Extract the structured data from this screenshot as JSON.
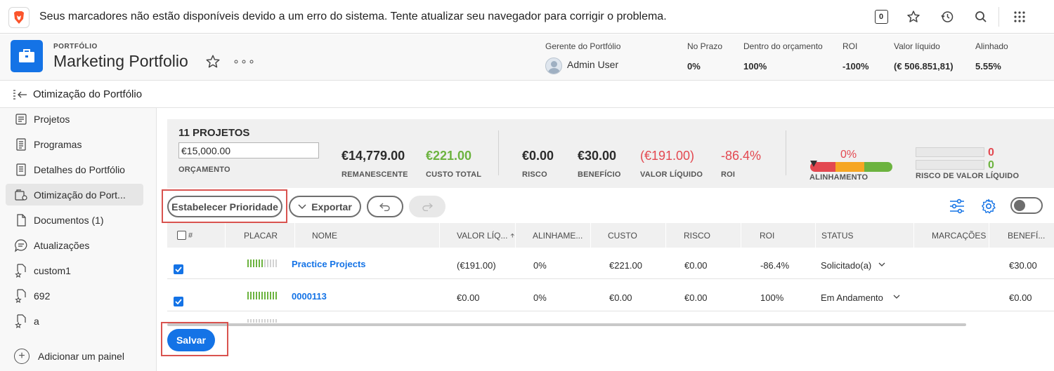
{
  "notice": {
    "text": "Seus marcadores não estão disponíveis devido a um erro do sistema. Tente atualizar seu navegador para corrigir o problema.",
    "counter": "0"
  },
  "header": {
    "label": "PORTFÓLIO",
    "title": "Marketing Portfolio",
    "more": "∘∘∘",
    "metrics": [
      {
        "label": "Gerente do Portfólio",
        "value": "Admin User"
      },
      {
        "label": "No Prazo",
        "value": "0%"
      },
      {
        "label": "Dentro do orçamento",
        "value": "100%"
      },
      {
        "label": "ROI",
        "value": "-100%"
      },
      {
        "label": "Valor líquido",
        "value": "(€ 506.851,81)"
      },
      {
        "label": "Alinhado",
        "value": "5.55%"
      }
    ]
  },
  "breadcrumb": {
    "text": "Otimização do Portfólio"
  },
  "sidebar": {
    "items": [
      {
        "label": "Projetos",
        "icon": "projects-icon"
      },
      {
        "label": "Programas",
        "icon": "programs-icon"
      },
      {
        "label": "Detalhes do Portfólio",
        "icon": "details-icon"
      },
      {
        "label": "Otimização do Port...",
        "icon": "optimizer-icon",
        "active": true
      },
      {
        "label": "Documentos (1)",
        "icon": "documents-icon"
      },
      {
        "label": "Atualizações",
        "icon": "updates-icon"
      },
      {
        "label": "custom1",
        "icon": "custom-report-icon"
      },
      {
        "label": "692",
        "icon": "custom-report-icon"
      },
      {
        "label": "a",
        "icon": "custom-report-icon"
      }
    ],
    "add_panel": "Adicionar um painel"
  },
  "summary": {
    "title": "11 PROJETOS",
    "budget_value": "€15,000.00",
    "budget_caption": "ORÇAMENTO",
    "remaining": {
      "value": "€14,779.00",
      "caption": "REMANESCENTE"
    },
    "total_cost": {
      "value": "€221.00",
      "caption": "CUSTO TOTAL"
    },
    "risk": {
      "value": "€0.00",
      "caption": "RISCO"
    },
    "benefit": {
      "value": "€30.00",
      "caption": "BENEFÍCIO"
    },
    "net_value": {
      "value": "(€191.00)",
      "caption": "VALOR LÍQUIDO"
    },
    "roi": {
      "value": "-86.4%",
      "caption": "ROI"
    },
    "alignment": {
      "value": "0%",
      "caption": "ALINHAMENTO"
    },
    "net_value_risk": {
      "value_top": "0",
      "value_bottom": "0",
      "caption": "RISCO DE VALOR LÍQUIDO"
    }
  },
  "toolbar": {
    "prioritize": "Estabelecer Prioridade",
    "export": "Exportar"
  },
  "table": {
    "headers": [
      "#",
      "PLACAR",
      "NOME",
      "VALOR LÍQ...",
      "ALINHAME...",
      "CUSTO",
      "RISCO",
      "ROI",
      "STATUS",
      "MARCAÇÕES",
      "BENEFÍ..."
    ],
    "rows": [
      {
        "name": "Practice Projects",
        "net_value": "(€191.00)",
        "alignment": "0%",
        "cost": "€221.00",
        "risk": "€0.00",
        "roi": "-86.4%",
        "status": "Solicitado(a)",
        "benefit": "€30.00"
      },
      {
        "name": "0000113",
        "net_value": "€0.00",
        "alignment": "0%",
        "cost": "€0.00",
        "risk": "€0.00",
        "roi": "100%",
        "status": "Em Andamento",
        "benefit": "€0.00"
      }
    ]
  },
  "save_label": "Salvar",
  "colors": {
    "accent": "#1473e6",
    "positive": "#6cb33f",
    "negative": "#e34850",
    "highlight": "#d9534f"
  }
}
